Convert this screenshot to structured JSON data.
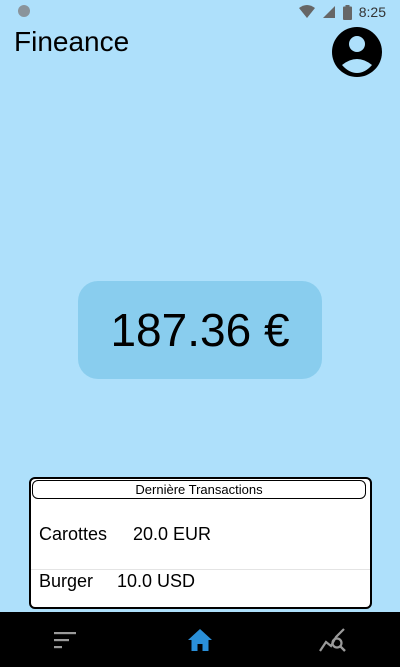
{
  "status_bar": {
    "time": "8:25"
  },
  "app": {
    "title": "Fineance"
  },
  "balance": {
    "amount": "187.36 €"
  },
  "transactions": {
    "title": "Dernière Transactions",
    "items": [
      {
        "name": "Carottes",
        "amount": "20.0 EUR"
      },
      {
        "name": "Burger",
        "amount": "10.0 USD"
      }
    ]
  },
  "nav": {
    "items": [
      {
        "icon": "sort-list-icon"
      },
      {
        "icon": "home-icon",
        "active": true
      },
      {
        "icon": "chart-search-icon"
      }
    ]
  },
  "colors": {
    "background": "#aee0fb",
    "balance_card": "#89cdee",
    "nav_active": "#2a8fd8",
    "nav_bar": "#000000"
  }
}
